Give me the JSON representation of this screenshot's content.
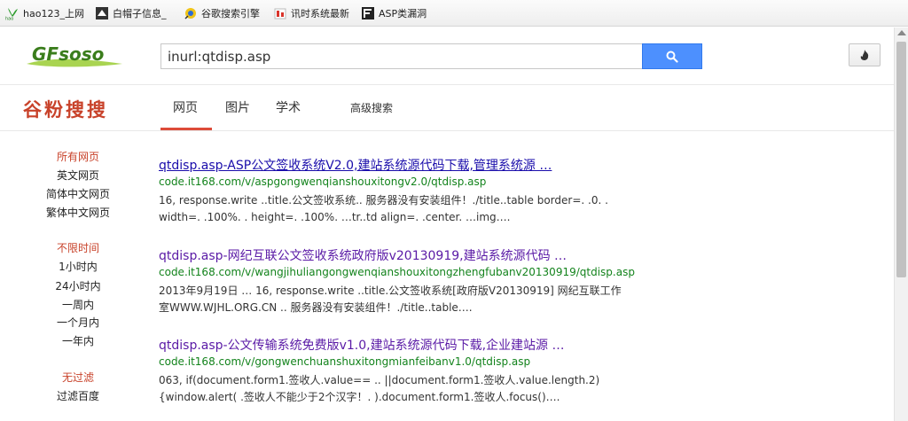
{
  "bookmarks": [
    {
      "label": "hao123_上网",
      "icon": "hao123-icon"
    },
    {
      "label": "白帽子信息_",
      "icon": "whitehat-icon"
    },
    {
      "label": "谷歌搜索引擎",
      "icon": "google-search-icon"
    },
    {
      "label": "讯时系统最新",
      "icon": "xunshi-icon"
    },
    {
      "label": "ASP类漏洞",
      "icon": "asp-vuln-icon"
    }
  ],
  "header": {
    "logo_text": "GFsoso",
    "search_value": "inurl:qtdisp.asp",
    "search_icon": "search-icon",
    "fire_icon": "fire-icon"
  },
  "nav": {
    "brand": "谷粉搜搜",
    "tabs": [
      "网页",
      "图片",
      "学术"
    ],
    "advanced": "高级搜索",
    "active_color": "#dd4b39"
  },
  "filters": {
    "lang_head": "所有网页",
    "lang_items": [
      "英文网页",
      "简体中文网页",
      "繁体中文网页"
    ],
    "time_head": "不限时间",
    "time_items": [
      "1小时内",
      "24小时内",
      "一周内",
      "一个月内",
      "一年内"
    ],
    "filter_head": "无过滤",
    "filter_items": [
      "过滤百度"
    ]
  },
  "results": [
    {
      "title": "qtdisp.asp-ASP公文签收系统V2.0,建站系统源代码下载,管理系统源 …",
      "url": "code.it168.com/v/aspgongwenqianshouxitongv2.0/qtdisp.asp",
      "snippet_1": "16, response.write ..title.公文签收系统.. 服务器没有安装组件！./title..table border=. .0. .",
      "snippet_2": "width=. .100%. . height=. .100%. …tr..td align=. .center. …img…."
    },
    {
      "title": "qtdisp.asp-网纪互联公文签收系统政府版v20130919,建站系统源代码 …",
      "url": "code.it168.com/v/wangjihuliangongwenqianshouxitongzhengfubanv20130919/qtdisp.asp",
      "snippet_1": "2013年9月19日 … 16, response.write ..title.公文签收系统[政府版V20130919] 网纪互联工作",
      "snippet_2": "室WWW.WJHL.ORG.CN .. 服务器没有安装组件！./title..table…."
    },
    {
      "title": "qtdisp.asp-公文传输系统免费版v1.0,建站系统源代码下载,企业建站源 …",
      "url": "code.it168.com/v/gongwenchuanshuxitongmianfeibanv1.0/qtdisp.asp",
      "snippet_1": "063, if(document.form1.签收人.value== .. ||document.form1.签收人.value.length.2)",
      "snippet_2": "{window.alert( .签收人不能少于2个汉字！. ).document.form1.签收人.focus()…."
    }
  ]
}
